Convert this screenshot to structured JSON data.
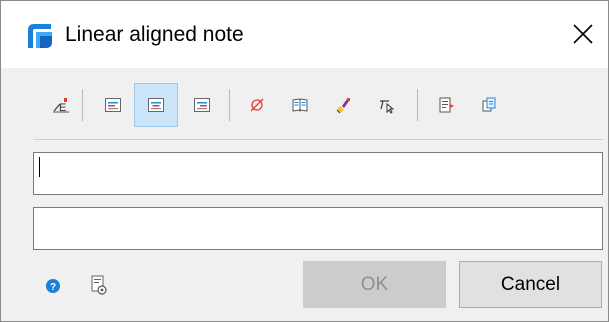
{
  "window": {
    "title": "Linear aligned note",
    "app_icon": "solidworks-app-icon",
    "close_icon": "close-icon"
  },
  "toolbar": {
    "buttons": [
      {
        "icon": "note-add-icon",
        "active": false
      },
      {
        "icon": "align-left-icon",
        "active": false
      },
      {
        "icon": "align-center-icon",
        "active": true
      },
      {
        "icon": "align-right-icon",
        "active": false
      },
      {
        "icon": "diameter-symbol-icon",
        "active": false
      },
      {
        "icon": "symbol-library-icon",
        "active": false
      },
      {
        "icon": "format-painter-icon",
        "active": false
      },
      {
        "icon": "leader-pick-icon",
        "active": false
      },
      {
        "icon": "insert-text-icon",
        "active": false
      },
      {
        "icon": "copy-icon",
        "active": false
      }
    ]
  },
  "fields": {
    "line1_value": "",
    "line2_value": ""
  },
  "footer": {
    "help_icon": "help-icon",
    "settings_icon": "settings-icon",
    "ok_label": "OK",
    "cancel_label": "Cancel"
  },
  "colors": {
    "active_bg": "#cce4f7",
    "dialog_bg": "#f0f0f0",
    "ok_disabled_bg": "#cccccc"
  }
}
